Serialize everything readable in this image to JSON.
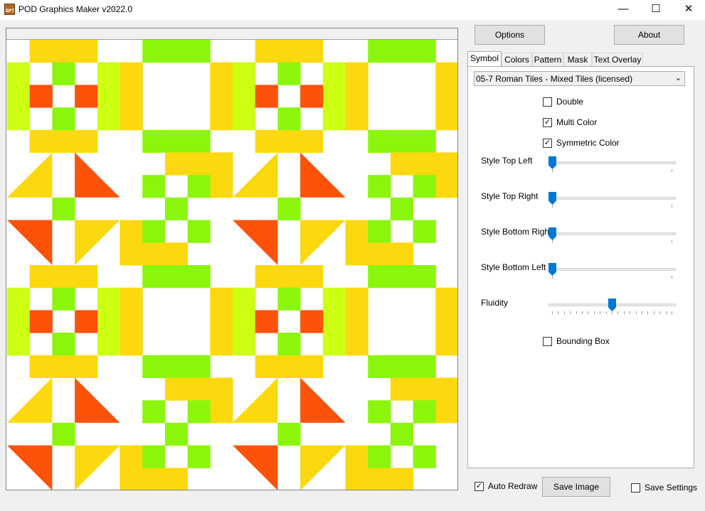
{
  "window": {
    "title": "POD Graphics Maker v2022.0",
    "icon_text": "BPT",
    "minimize_glyph": "—",
    "maximize_glyph": "☐",
    "close_glyph": "✕"
  },
  "toolbar": {
    "options_label": "Options",
    "about_label": "About"
  },
  "tabs": [
    {
      "label": "Symbol",
      "active": true
    },
    {
      "label": "Colors",
      "active": false
    },
    {
      "label": "Pattern",
      "active": false
    },
    {
      "label": "Mask",
      "active": false
    },
    {
      "label": "Text Overlay",
      "active": false
    }
  ],
  "symbol": {
    "selected": "05-7 Roman Tiles - Mixed Tiles (licensed)",
    "double": {
      "label": "Double",
      "checked": false
    },
    "multi_color": {
      "label": "Multi Color",
      "checked": true
    },
    "symmetric_color": {
      "label": "Symmetric Color",
      "checked": true
    },
    "sliders": [
      {
        "label": "Style Top Left",
        "value": 0
      },
      {
        "label": "Style Top Right",
        "value": 0
      },
      {
        "label": "Style Bottom Right",
        "value": 0
      },
      {
        "label": "Style Bottom Left",
        "value": 0
      },
      {
        "label": "Fluidity",
        "value": 0.5
      }
    ],
    "bounding_box": {
      "label": "Bounding Box",
      "checked": false
    }
  },
  "bottom": {
    "auto_redraw": {
      "label": "Auto Redraw",
      "checked": true
    },
    "save_image_label": "Save Image",
    "save_settings": {
      "label": "Save Settings",
      "checked": false
    }
  },
  "check_glyph": "✓",
  "colors": {
    "yellow": "#fcd80e",
    "lime": "#ccff11",
    "green": "#8cf50c",
    "orange": "#fc520a",
    "background": "#ffffff",
    "accent": "#0078d7"
  }
}
